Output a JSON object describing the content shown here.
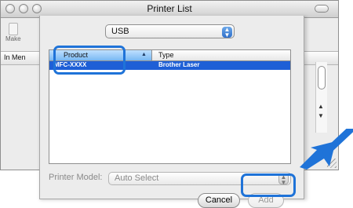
{
  "window": {
    "title": "Printer List"
  },
  "background": {
    "toolbar_button": "Make",
    "list_header": "In Men"
  },
  "sheet": {
    "connection_select": {
      "value": "USB"
    },
    "table": {
      "columns": {
        "product": "Product",
        "type": "Type"
      },
      "rows": [
        {
          "product": "MFC-XXXX",
          "type": "Brother Laser"
        }
      ]
    },
    "printer_model_label": "Printer Model:",
    "printer_model_select": {
      "value": "Auto Select"
    },
    "buttons": {
      "cancel": "Cancel",
      "add": "Add"
    }
  },
  "colors": {
    "highlight": "#1f73d8",
    "selection": "#1e5fd6"
  },
  "icons": {
    "callout_arrow": "arrow-pointing-to-add-button",
    "sort_indicator": "sort-ascending-icon"
  }
}
